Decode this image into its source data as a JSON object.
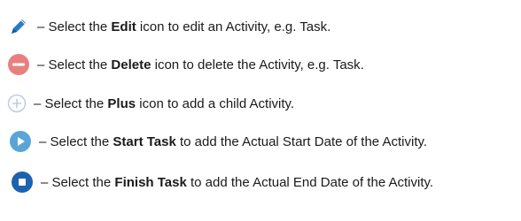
{
  "colors": {
    "edit": "#2b7bc6",
    "delete": "#e88080",
    "plus": "#b9cde8",
    "start": "#5ba4d8",
    "finish": "#1d62b0"
  },
  "items": [
    {
      "icon": "pencil-icon",
      "dash": "–",
      "pre": "Select the",
      "bold": "Edit",
      "post": "icon to edit an Activity, e.g. Task."
    },
    {
      "icon": "minus-circle-icon",
      "dash": "–",
      "pre": "Select the",
      "bold": "Delete",
      "post": "icon to delete the Activity, e.g. Task."
    },
    {
      "icon": "plus-circle-icon",
      "dash": "–",
      "pre": "Select the",
      "bold": "Plus",
      "post": "icon to add a child Activity."
    },
    {
      "icon": "play-circle-icon",
      "dash": "–",
      "pre": "Select the",
      "bold": "Start Task",
      "post": "to add the Actual Start Date of the Activity."
    },
    {
      "icon": "stop-circle-icon",
      "dash": "–",
      "pre": "Select the",
      "bold": "Finish Task",
      "post": "to add the Actual End Date of the Activity."
    }
  ]
}
